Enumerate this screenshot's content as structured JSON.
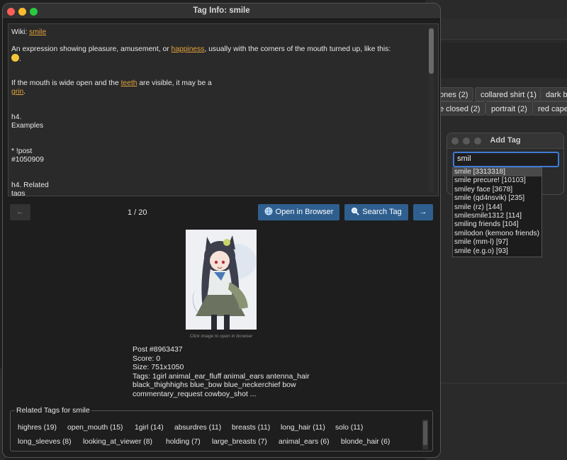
{
  "background_window": {
    "chips_row1": [
      "ones (2)",
      "collared shirt (1)",
      "dark ba"
    ],
    "chips_row2": [
      "e closed (2)",
      "portrait (2)",
      "red cape"
    ]
  },
  "add_tag_window": {
    "title": "Add Tag",
    "input_value": "smil",
    "suggestions": [
      "smile [3313318]",
      "smile precure! [10103]",
      "smiley face [3678]",
      "smile (qd4nsvik) [235]",
      "smile (rz) [144]",
      "smilesmile1312 [114]",
      "smiling friends [104]",
      "smilodon (kemono friends) [",
      "smile (mm-l) [97]",
      "smile (e.g.o) [93]"
    ]
  },
  "main_window": {
    "title": "Tag Info: smile",
    "wiki": {
      "prefix": "Wiki: ",
      "tag_link": "smile",
      "desc_before": "An expression showing pleasure, amusement, or ",
      "desc_link": "happiness",
      "desc_after": ", usually with the corners of the mouth turned up, like this:",
      "emoji_suffix": ".",
      "teeth_before": "If the mouth is wide open and the ",
      "teeth_link": "teeth",
      "teeth_after": " are visible, it may be a",
      "grin_link": "grin",
      "grin_after": ".",
      "h4_examples": "h4.",
      "examples": "Examples",
      "post_bullet": "* !post",
      "post_id": "#1050909",
      "h4_related": "h4. Related",
      "related_tags_word": "tags"
    },
    "nav": {
      "prev_icon": "←",
      "counter": "1 / 20",
      "open_browser": "Open in Browser",
      "search_tag": "Search Tag",
      "next_icon": "→"
    },
    "image_caption": "Click image to open in browser",
    "post": {
      "id": "Post #8963437",
      "score": "Score: 0",
      "size": "Size: 751x1050",
      "tags_line1": "Tags: 1girl animal_ear_fluff animal_ears antenna_hair",
      "tags_line2": "black_thighhighs blue_bow blue_neckerchief bow",
      "tags_line3": "commentary_request cowboy_shot ..."
    },
    "related": {
      "label": "Related Tags for smile",
      "row1": [
        "highres (19)",
        "open_mouth (15)",
        "1girl (14)",
        "absurdres (11)",
        "breasts (11)",
        "long_hair (11)",
        "solo (11)"
      ],
      "row2": [
        "long_sleeves (8)",
        "looking_at_viewer (8)",
        "holding (7)",
        "large_breasts (7)",
        "animal_ears (6)",
        "blonde_hair (6)"
      ]
    }
  },
  "colors": {
    "link": "#e2a33c",
    "button_blue": "#2f5f8f",
    "close": "#ff5f57",
    "minimize": "#febc2e",
    "maximize": "#28c840"
  }
}
